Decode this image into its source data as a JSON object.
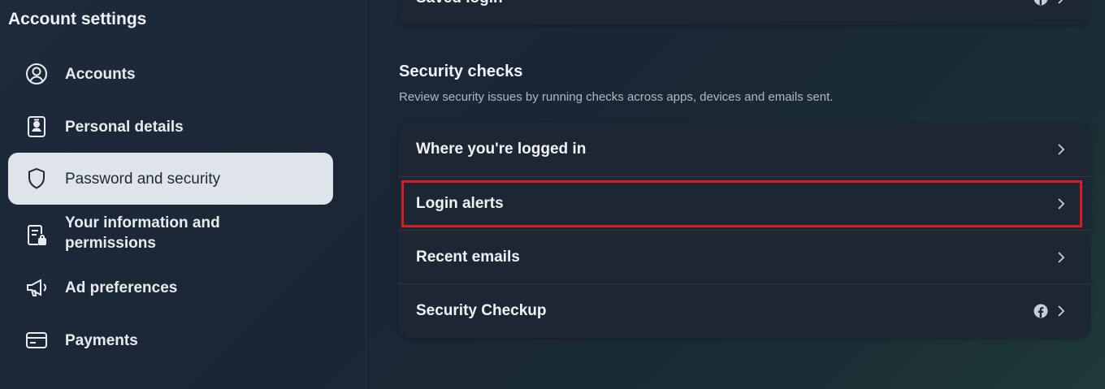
{
  "sidebar": {
    "title": "Account settings",
    "items": [
      {
        "label": "Accounts",
        "icon": "user-circle-icon"
      },
      {
        "label": "Personal details",
        "icon": "id-card-icon"
      },
      {
        "label": "Password and security",
        "icon": "shield-icon",
        "active": true
      },
      {
        "label": "Your information and permissions",
        "icon": "document-lock-icon"
      },
      {
        "label": "Ad preferences",
        "icon": "megaphone-icon"
      },
      {
        "label": "Payments",
        "icon": "credit-card-icon"
      }
    ]
  },
  "main": {
    "top_card": {
      "label": "Saved login"
    },
    "security_checks": {
      "title": "Security checks",
      "description": "Review security issues by running checks across apps, devices and emails sent.",
      "rows": [
        {
          "label": "Where you're logged in"
        },
        {
          "label": "Login alerts",
          "highlighted": true
        },
        {
          "label": "Recent emails"
        },
        {
          "label": "Security Checkup",
          "has_facebook_icon": true
        }
      ]
    }
  },
  "colors": {
    "highlight": "#d71c25",
    "active_nav_bg": "#dfe3ea",
    "card_bg": "#1c2733"
  }
}
